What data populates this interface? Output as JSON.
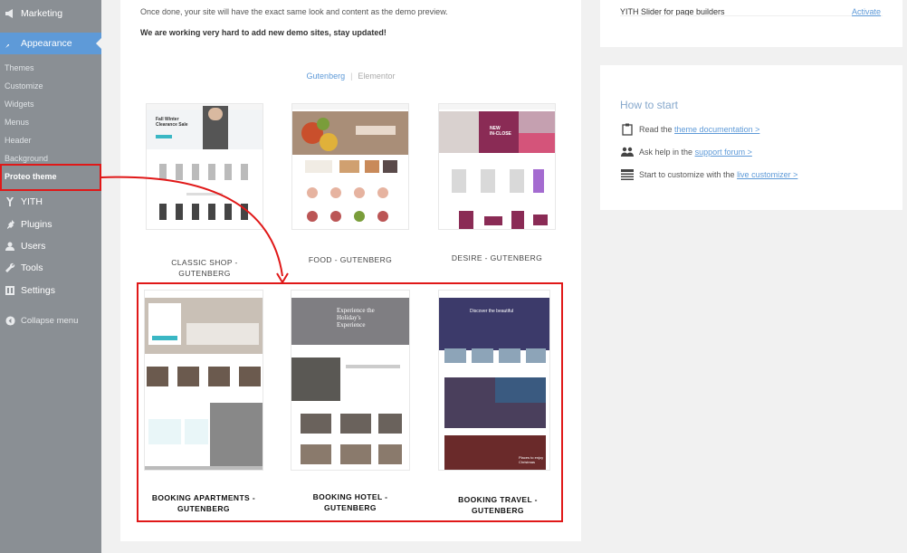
{
  "sidebar": {
    "items": [
      {
        "label": "Marketing",
        "icon": "megaphone-icon"
      },
      {
        "label": "Appearance",
        "icon": "paintbrush-icon"
      },
      {
        "label": "YITH",
        "icon": "yith-icon"
      },
      {
        "label": "Plugins",
        "icon": "plug-icon"
      },
      {
        "label": "Users",
        "icon": "user-icon"
      },
      {
        "label": "Tools",
        "icon": "wrench-icon"
      },
      {
        "label": "Settings",
        "icon": "settings-icon"
      }
    ],
    "submenu": [
      "Themes",
      "Customize",
      "Widgets",
      "Menus",
      "Header",
      "Background",
      "Proteo theme"
    ],
    "collapse_label": "Collapse menu"
  },
  "main": {
    "intro_line1": "Once done, your site will have the exact same look and content as the demo preview.",
    "intro_line2": "We are working very hard to add new demo sites, stay updated!",
    "filter_active": "Gutenberg",
    "filter_inactive": "Elementor",
    "demos": [
      {
        "label_line1": "CLASSIC SHOP -",
        "label_line2": "GUTENBERG"
      },
      {
        "label_line1": "FOOD - GUTENBERG",
        "label_line2": ""
      },
      {
        "label_line1": "DESIRE - GUTENBERG",
        "label_line2": ""
      },
      {
        "label_line1": "BOOKING APARTMENTS -",
        "label_line2": "GUTENBERG"
      },
      {
        "label_line1": "BOOKING HOTEL -",
        "label_line2": "GUTENBERG"
      },
      {
        "label_line1": "BOOKING TRAVEL -",
        "label_line2": "GUTENBERG"
      }
    ],
    "thumb_text": {
      "classic_banner_line1": "Fall Winter",
      "classic_banner_line2": "Clearance Sale",
      "desire_banner_line1": "NEW",
      "desire_banner_line2": "IN-CLOSE",
      "hotel_banner_line1": "Experience the",
      "hotel_banner_line2": "Holiday's",
      "hotel_banner_line3": "Experience",
      "travel_banner": "Discover the beautiful",
      "travel_tile_line1": "Places to enjoy",
      "travel_tile_line2": "Christmas"
    }
  },
  "right": {
    "plugin_name": "YITH Slider for page builders",
    "plugin_action": "Activate",
    "how_title": "How to start",
    "rows": [
      {
        "prefix": "Read the ",
        "link": "theme documentation >",
        "icon": "clipboard-icon"
      },
      {
        "prefix": "Ask help in the ",
        "link": "support forum >",
        "icon": "users-icon"
      },
      {
        "prefix": "Start to customize with the ",
        "link": "live customizer >",
        "icon": "layout-icon"
      }
    ]
  },
  "colors": {
    "accent": "#5e9ad8",
    "highlight": "#e01818",
    "sidebar": "#8a8f94"
  }
}
